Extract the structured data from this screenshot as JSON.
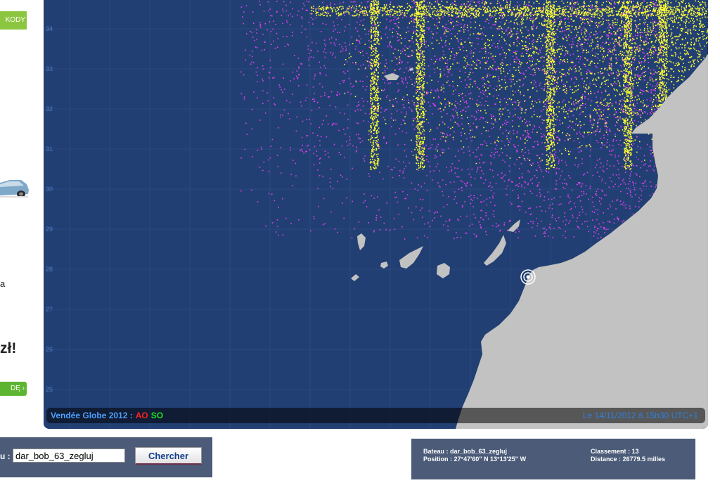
{
  "ad": {
    "top_button": "KODY",
    "text_a": "a",
    "price": "zł!",
    "bottom_button": "DĘ ›"
  },
  "map": {
    "latitude_labels": [
      "34",
      "33",
      "32",
      "31",
      "30",
      "29",
      "28",
      "27",
      "26",
      "25"
    ],
    "status": {
      "title": "Vendée Globe 2012 :",
      "ao": "AO",
      "so": "SO",
      "date": "Le 14/11/2012 à 15h30 UTC+1"
    },
    "colors": {
      "ocean": "#223f73",
      "land": "#c2c2c2",
      "track_magenta": "#e040f0",
      "track_yellow": "#ffff33"
    },
    "marker_icon": "boat-position-target-icon"
  },
  "search": {
    "label": "u :",
    "input_value": "dar_bob_63_zegluj",
    "button_label": "Chercher"
  },
  "info": {
    "boat_line": "Bateau : dar_bob_63_zegluj",
    "position_line": "Position : 27°47'60\" N  13°13'25\" W",
    "rank_line": "Classement : 13",
    "distance_line": "Distance : 26779.5 milles"
  }
}
